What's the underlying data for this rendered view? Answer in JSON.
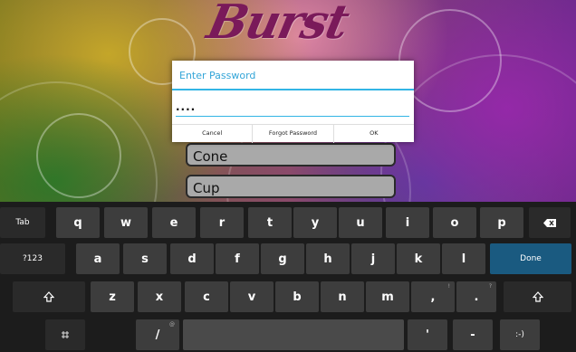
{
  "app": {
    "title": "Burst",
    "list_items": [
      "Cone",
      "Cup"
    ]
  },
  "dialog": {
    "title": "Enter Password",
    "password_value": "....",
    "buttons": {
      "cancel": "Cancel",
      "forgot": "Forgot Password",
      "ok": "OK"
    }
  },
  "keyboard": {
    "row1": [
      "Tab",
      "q",
      "w",
      "e",
      "r",
      "t",
      "y",
      "u",
      "i",
      "o",
      "p"
    ],
    "row2": [
      "?123",
      "a",
      "s",
      "d",
      "f",
      "g",
      "h",
      "j",
      "k",
      "l",
      "Done"
    ],
    "row3": [
      "z",
      "x",
      "c",
      "v",
      "b",
      "n",
      "m",
      ",",
      "."
    ],
    "row3_hints": [
      "!",
      "?"
    ],
    "row4": [
      "/",
      "'",
      "-",
      ":-)"
    ],
    "row4_hint": "@",
    "icons": [
      "backspace-icon",
      "shift-icon",
      "settings-icon"
    ],
    "colors": {
      "done_key": "#1a5a80",
      "accent": "#33b5e5"
    }
  }
}
